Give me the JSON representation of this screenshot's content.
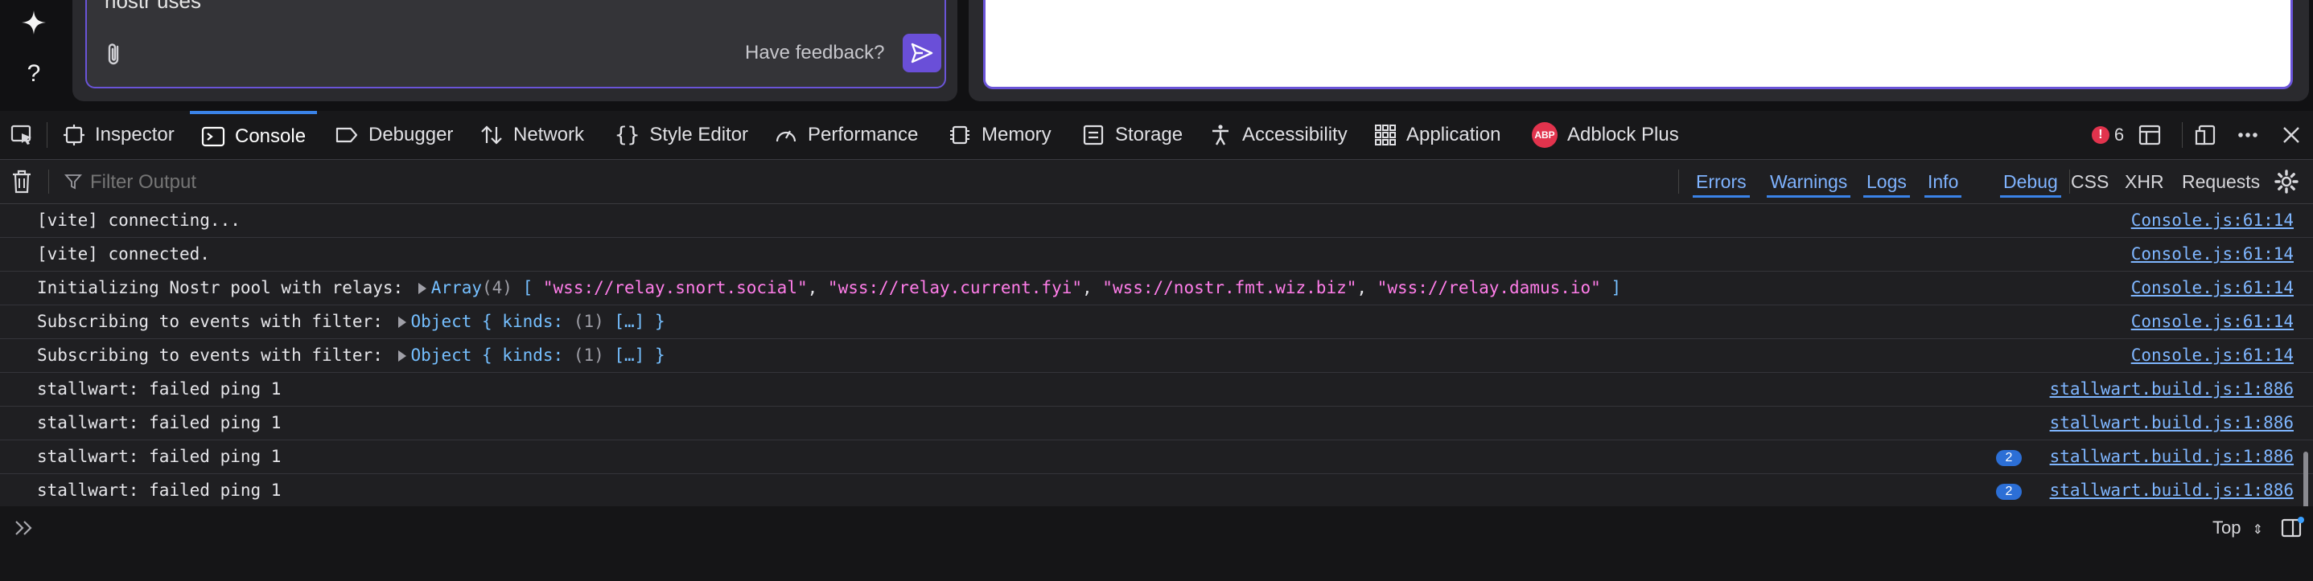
{
  "chat": {
    "input_value": "nostr uses",
    "feedback_label": "Have feedback?"
  },
  "rail": {
    "top_icon": "sparkle-icon",
    "help_label": "?"
  },
  "devtools": {
    "tabs": [
      {
        "label": "Inspector",
        "icon": "inspector-icon"
      },
      {
        "label": "Console",
        "icon": "console-icon",
        "selected": true
      },
      {
        "label": "Debugger",
        "icon": "debugger-icon"
      },
      {
        "label": "Network",
        "icon": "network-icon"
      },
      {
        "label": "Style Editor",
        "icon": "braces-icon"
      },
      {
        "label": "Performance",
        "icon": "gauge-icon"
      },
      {
        "label": "Memory",
        "icon": "chip-icon"
      },
      {
        "label": "Storage",
        "icon": "storage-icon"
      },
      {
        "label": "Accessibility",
        "icon": "accessibility-icon"
      },
      {
        "label": "Application",
        "icon": "grid-icon"
      },
      {
        "label": "Adblock Plus",
        "icon": "abp-icon"
      }
    ],
    "abp_logo_text": "ABP",
    "error_count": "6",
    "error_color": "#e2334d",
    "filter_placeholder": "Filter Output",
    "filter_levels": [
      "Errors",
      "Warnings",
      "Logs",
      "Info",
      "Debug"
    ],
    "net_filters": [
      "CSS",
      "XHR",
      "Requests"
    ],
    "context_selector": "Top",
    "accent_color": "#3a83e8"
  },
  "console": {
    "rows": [
      {
        "text": "[vite] connecting...",
        "source": "Console.js:61:14"
      },
      {
        "text": "[vite] connected.",
        "source": "Console.js:61:14"
      },
      {
        "prefix": "Initializing Nostr pool with relays: ",
        "type": "Array",
        "count": "(4)",
        "items": [
          "\"wss://relay.snort.social\"",
          "\"wss://relay.current.fyi\"",
          "\"wss://nostr.fmt.wiz.biz\"",
          "\"wss://relay.damus.io\""
        ],
        "source": "Console.js:61:14"
      },
      {
        "prefix": "Subscribing to events with filter: ",
        "object": "Object { kinds: ",
        "count": "(1)",
        "rest": " […] }",
        "source": "Console.js:61:14"
      },
      {
        "prefix": "Subscribing to events with filter: ",
        "object": "Object { kinds: ",
        "count": "(1)",
        "rest": " […] }",
        "source": "Console.js:61:14"
      },
      {
        "text": "stallwart: failed ping 1",
        "source": "stallwart.build.js:1:886"
      },
      {
        "text": "stallwart: failed ping 1",
        "source": "stallwart.build.js:1:886"
      },
      {
        "text": "stallwart: failed ping 1",
        "source": "stallwart.build.js:1:886",
        "repeat": "2"
      },
      {
        "text": "stallwart: failed ping 1",
        "source": "stallwart.build.js:1:886",
        "repeat": "2"
      }
    ]
  }
}
